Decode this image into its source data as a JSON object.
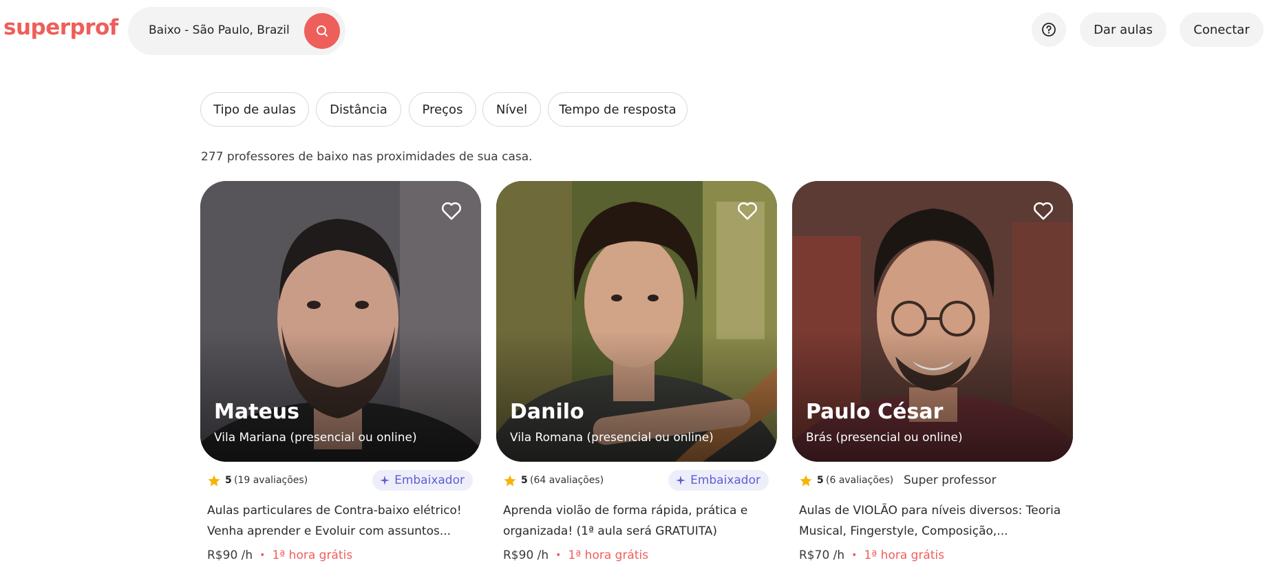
{
  "header": {
    "logo": "superprof",
    "search_value": "Baixo - São Paulo, Brazil",
    "teach_label": "Dar aulas",
    "connect_label": "Conectar",
    "brand_color": "#ee5e5a"
  },
  "filters": [
    {
      "label": "Tipo de aulas"
    },
    {
      "label": "Distância"
    },
    {
      "label": "Preços"
    },
    {
      "label": "Nível"
    },
    {
      "label": "Tempo de resposta"
    }
  ],
  "results_count_text": "277 professores de baixo nas proximidades de sua casa.",
  "teachers": [
    {
      "name": "Mateus",
      "location": "Vila Mariana (presencial ou online)",
      "rating": "5",
      "reviews": "(19 avaliações)",
      "badge": "Embaixador",
      "description": "Aulas particulares de Contra-baixo elétrico! Venha aprender e Evoluir com assuntos...",
      "price": "R$90 /h",
      "free_lesson": "1ª hora grátis"
    },
    {
      "name": "Danilo",
      "location": "Vila Romana (presencial ou online)",
      "rating": "5",
      "reviews": "(64 avaliações)",
      "badge": "Embaixador",
      "description": "Aprenda violão de forma rápida, prática e organizada! (1ª aula será GRATUITA)",
      "price": "R$90 /h",
      "free_lesson": "1ª hora grátis"
    },
    {
      "name": "Paulo César",
      "location": "Brás (presencial ou online)",
      "rating": "5",
      "reviews": "(6 avaliações)",
      "badge": "Super professor",
      "description": "Aulas de VIOLÃO para níveis diversos: Teoria Musical, Fingerstyle, Composição,...",
      "price": "R$70 /h",
      "free_lesson": "1ª hora grátis"
    }
  ]
}
